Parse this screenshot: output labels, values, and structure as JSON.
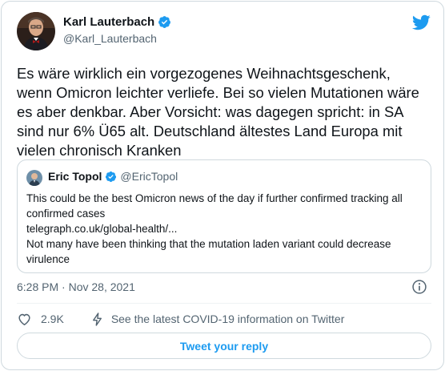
{
  "author": {
    "name": "Karl Lauterbach",
    "handle": "@Karl_Lauterbach",
    "avatar_icon": "person-photo",
    "verified": true
  },
  "tweet": {
    "text": "Es wäre wirklich ein vorgezogenes Weihnachtsgeschenk,\nwenn Omicron leichter verliefe. Bei so vielen Mutationen wäre\nes aber denkbar. Aber Vorsicht: was dagegen spricht: in SA\nsind nur 6% Ü65 alt. Deutschland ältestes Land Europa mit\nvielen chronisch Kranken",
    "timestamp": "6:28 PM · Nov 28, 2021"
  },
  "quoted": {
    "name": "Eric Topol",
    "handle": "@EricTopol",
    "lines": [
      "This could be the best Omicron news of the day if further confirmed tracking all",
      "confirmed cases",
      "telegraph.co.uk/global-health/...",
      "Not many have been thinking that the mutation laden variant could decrease",
      "virulence"
    ]
  },
  "actions": {
    "like_count": "2.9K",
    "covid_info": "See the latest COVID-19 information on Twitter",
    "reply_label": "Tweet your reply"
  },
  "colors": {
    "accent": "#1d9bf0",
    "text": "#0f1419",
    "secondary": "#536471",
    "border": "#cfd9de"
  }
}
